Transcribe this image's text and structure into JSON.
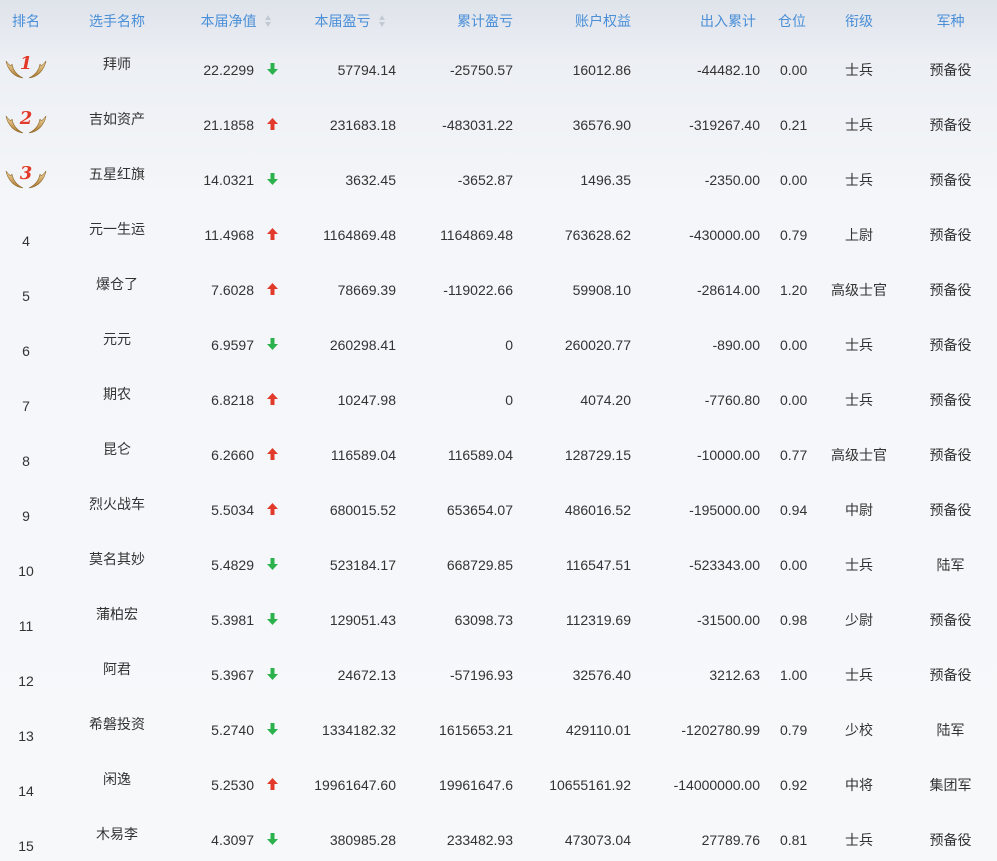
{
  "table": {
    "headers": {
      "rank": "排名",
      "name": "选手名称",
      "nav": "本届净值",
      "cur": "本届盈亏",
      "cum": "累计盈亏",
      "equity": "账户权益",
      "io": "出入累计",
      "pos": "仓位",
      "title": "衔级",
      "arm": "军种"
    },
    "colors": {
      "header_text": "#4a8fd8",
      "up_arrow": "#e23a2a",
      "down_arrow": "#2bb24c"
    },
    "rows": [
      {
        "rank": "1",
        "medal": true,
        "name": "拜师",
        "nav": "22.2299",
        "dir": "down",
        "cur": "57794.14",
        "cum": "-25750.57",
        "equity": "16012.86",
        "io": "-44482.10",
        "pos": "0.00",
        "title": "士兵",
        "arm": "预备役"
      },
      {
        "rank": "2",
        "medal": true,
        "name": "吉如资产",
        "nav": "21.1858",
        "dir": "up",
        "cur": "231683.18",
        "cum": "-483031.22",
        "equity": "36576.90",
        "io": "-319267.40",
        "pos": "0.21",
        "title": "士兵",
        "arm": "预备役"
      },
      {
        "rank": "3",
        "medal": true,
        "name": "五星红旗",
        "nav": "14.0321",
        "dir": "down",
        "cur": "3632.45",
        "cum": "-3652.87",
        "equity": "1496.35",
        "io": "-2350.00",
        "pos": "0.00",
        "title": "士兵",
        "arm": "预备役"
      },
      {
        "rank": "4",
        "medal": false,
        "name": "元一生运",
        "nav": "11.4968",
        "dir": "up",
        "cur": "1164869.48",
        "cum": "1164869.48",
        "equity": "763628.62",
        "io": "-430000.00",
        "pos": "0.79",
        "title": "上尉",
        "arm": "预备役"
      },
      {
        "rank": "5",
        "medal": false,
        "name": "爆仓了",
        "nav": "7.6028",
        "dir": "up",
        "cur": "78669.39",
        "cum": "-119022.66",
        "equity": "59908.10",
        "io": "-28614.00",
        "pos": "1.20",
        "title": "高级士官",
        "arm": "预备役"
      },
      {
        "rank": "6",
        "medal": false,
        "name": "元元",
        "nav": "6.9597",
        "dir": "down",
        "cur": "260298.41",
        "cum": "0",
        "equity": "260020.77",
        "io": "-890.00",
        "pos": "0.00",
        "title": "士兵",
        "arm": "预备役"
      },
      {
        "rank": "7",
        "medal": false,
        "name": "期农",
        "nav": "6.8218",
        "dir": "up",
        "cur": "10247.98",
        "cum": "0",
        "equity": "4074.20",
        "io": "-7760.80",
        "pos": "0.00",
        "title": "士兵",
        "arm": "预备役"
      },
      {
        "rank": "8",
        "medal": false,
        "name": "昆仑",
        "nav": "6.2660",
        "dir": "up",
        "cur": "116589.04",
        "cum": "116589.04",
        "equity": "128729.15",
        "io": "-10000.00",
        "pos": "0.77",
        "title": "高级士官",
        "arm": "预备役"
      },
      {
        "rank": "9",
        "medal": false,
        "name": "烈火战车",
        "nav": "5.5034",
        "dir": "up",
        "cur": "680015.52",
        "cum": "653654.07",
        "equity": "486016.52",
        "io": "-195000.00",
        "pos": "0.94",
        "title": "中尉",
        "arm": "预备役"
      },
      {
        "rank": "10",
        "medal": false,
        "name": "莫名其妙",
        "nav": "5.4829",
        "dir": "down",
        "cur": "523184.17",
        "cum": "668729.85",
        "equity": "116547.51",
        "io": "-523343.00",
        "pos": "0.00",
        "title": "士兵",
        "arm": "陆军"
      },
      {
        "rank": "11",
        "medal": false,
        "name": "蒲柏宏",
        "nav": "5.3981",
        "dir": "down",
        "cur": "129051.43",
        "cum": "63098.73",
        "equity": "112319.69",
        "io": "-31500.00",
        "pos": "0.98",
        "title": "少尉",
        "arm": "预备役"
      },
      {
        "rank": "12",
        "medal": false,
        "name": "阿君",
        "nav": "5.3967",
        "dir": "down",
        "cur": "24672.13",
        "cum": "-57196.93",
        "equity": "32576.40",
        "io": "3212.63",
        "pos": "1.00",
        "title": "士兵",
        "arm": "预备役"
      },
      {
        "rank": "13",
        "medal": false,
        "name": "希磐投资",
        "nav": "5.2740",
        "dir": "down",
        "cur": "1334182.32",
        "cum": "1615653.21",
        "equity": "429110.01",
        "io": "-1202780.99",
        "pos": "0.79",
        "title": "少校",
        "arm": "陆军"
      },
      {
        "rank": "14",
        "medal": false,
        "name": "闲逸",
        "nav": "5.2530",
        "dir": "up",
        "cur": "19961647.60",
        "cum": "19961647.6",
        "equity": "10655161.92",
        "io": "-14000000.00",
        "pos": "0.92",
        "title": "中将",
        "arm": "集团军"
      },
      {
        "rank": "15",
        "medal": false,
        "name": "木易李",
        "nav": "4.3097",
        "dir": "down",
        "cur": "380985.28",
        "cum": "233482.93",
        "equity": "473073.04",
        "io": "27789.76",
        "pos": "0.81",
        "title": "士兵",
        "arm": "预备役"
      }
    ]
  }
}
